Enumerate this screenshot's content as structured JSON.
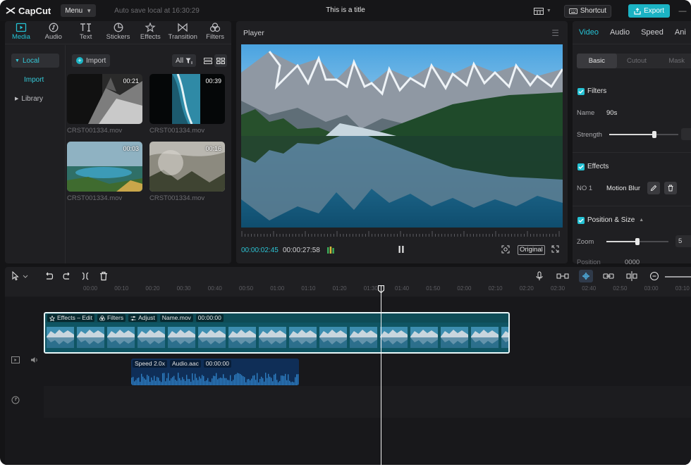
{
  "app": {
    "name": "CapCut",
    "menu_label": "Menu",
    "autosave": "Auto save local at 16:30:29",
    "title": "This is a title",
    "shortcut_label": "Shortcut",
    "export_label": "Export",
    "accent_color": "#25c2d4"
  },
  "media_panel": {
    "tabs": [
      {
        "label": "Media",
        "icon": "media-icon",
        "active": true
      },
      {
        "label": "Audio",
        "icon": "audio-icon",
        "active": false
      },
      {
        "label": "Text",
        "icon": "text-icon",
        "active": false
      },
      {
        "label": "Stickers",
        "icon": "sticker-icon",
        "active": false
      },
      {
        "label": "Effects",
        "icon": "effects-icon",
        "active": false
      },
      {
        "label": "Transition",
        "icon": "transition-icon",
        "active": false
      },
      {
        "label": "Filters",
        "icon": "filters-icon",
        "active": false
      }
    ],
    "nav": {
      "local": "Local",
      "import": "Import",
      "library": "Library"
    },
    "import_button": "Import",
    "filter_label": "All",
    "items": [
      {
        "name": "CRST001334.mov",
        "duration": "00:21"
      },
      {
        "name": "CRST001334.mov",
        "duration": "00:39"
      },
      {
        "name": "CRST001334.mov",
        "duration": "00:03"
      },
      {
        "name": "CRST001334.mov",
        "duration": "00:16"
      }
    ]
  },
  "player": {
    "title": "Player",
    "current_time": "00:00:02:45",
    "total_time": "00:00:27:58",
    "ratio_label": "Original"
  },
  "inspector": {
    "tabs": [
      "Video",
      "Audio",
      "Speed",
      "Ani"
    ],
    "segments": [
      "Basic",
      "Cutout",
      "Mask"
    ],
    "filters": {
      "title": "Filters",
      "name_label": "Name",
      "name_value": "90s",
      "strength_label": "Strength",
      "strength_value": 0.65
    },
    "effects": {
      "title": "Effects",
      "index": "NO 1",
      "name": "Motion Blur"
    },
    "position": {
      "title": "Position & Size",
      "zoom_label": "Zoom",
      "zoom_value": 0.5,
      "zoom_box": "5",
      "position_label": "Position",
      "position_value": "0000"
    }
  },
  "timeline": {
    "ruler_labels": [
      "00:00",
      "00:10",
      "00:20",
      "00:30",
      "00:40",
      "00:50",
      "01:00",
      "01:10",
      "01:20",
      "01:30",
      "01:40",
      "01:50",
      "02:00",
      "02:10",
      "02:20",
      "02:30",
      "02:40",
      "02:50",
      "03:00",
      "03:10"
    ],
    "video_clip": {
      "tags": [
        "Effects – Edit",
        "Filters",
        "Adjust",
        "Name.mov",
        "00:00:00"
      ]
    },
    "audio_clip": {
      "tags": [
        "Speed 2.0x",
        "Audio.aac",
        "00:00:00"
      ]
    }
  }
}
